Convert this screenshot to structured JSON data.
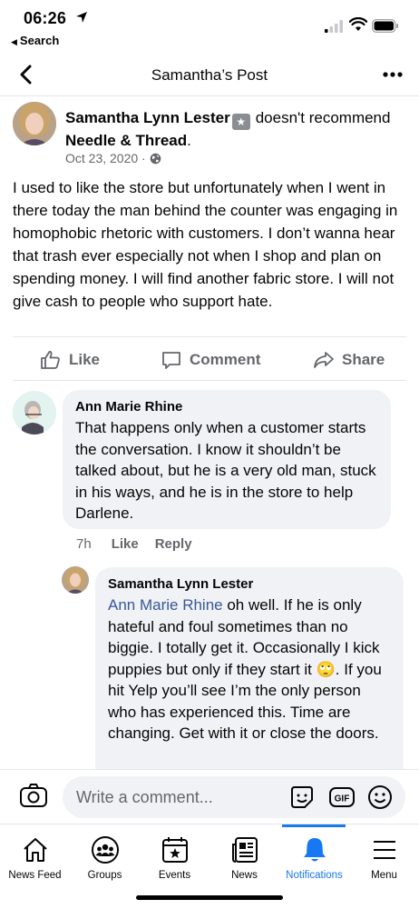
{
  "status_bar": {
    "time": "06:26",
    "back_label": "Search"
  },
  "nav": {
    "title": "Samantha’s Post"
  },
  "post": {
    "author": "Samantha Lynn Lester",
    "verb": "doesn't recommend",
    "page": "Needle & Thread",
    "date": "Oct 23, 2020 ·",
    "body": "I used to like the store but unfortunately when I went in there today the man behind the counter was engaging in homophobic rhetoric with customers. I don’t wanna hear that trash ever especially not when I shop and plan on spending money. I will find another fabric store. I will not give cash to people who support hate."
  },
  "actions": {
    "like": "Like",
    "comment": "Comment",
    "share": "Share"
  },
  "comments": [
    {
      "name": "Ann Marie Rhine",
      "text": "That happens only when a customer starts the conversation. I know it shouldn’t be talked about, but he is a very old man, stuck in his ways, and he is in the store to help Darlene.",
      "time": "7h",
      "like": "Like",
      "reply": "Reply"
    }
  ],
  "reply": {
    "name": "Samantha Lynn Lester",
    "mention": "Ann Marie Rhine",
    "text_1": " oh well. If he is only hateful and foul sometimes than no biggie. I totally get it. Occasionally I kick puppies but only if they start it ",
    "emoji": "🙄",
    "text_2": ". If you hit Yelp you’ll see I’m the only person who has experienced this. Time are changing. Get with it or close the doors."
  },
  "composer": {
    "placeholder": "Write a comment..."
  },
  "tabs": [
    {
      "label": "News Feed",
      "icon": "home-icon"
    },
    {
      "label": "Groups",
      "icon": "groups-icon"
    },
    {
      "label": "Events",
      "icon": "calendar-icon"
    },
    {
      "label": "News",
      "icon": "news-icon"
    },
    {
      "label": "Notifications",
      "icon": "bell-icon"
    },
    {
      "label": "Menu",
      "icon": "menu-icon"
    }
  ],
  "colors": {
    "accent": "#1877f2",
    "secondary_text": "#65676b",
    "bubble": "#f0f2f5",
    "mention": "#385898"
  }
}
